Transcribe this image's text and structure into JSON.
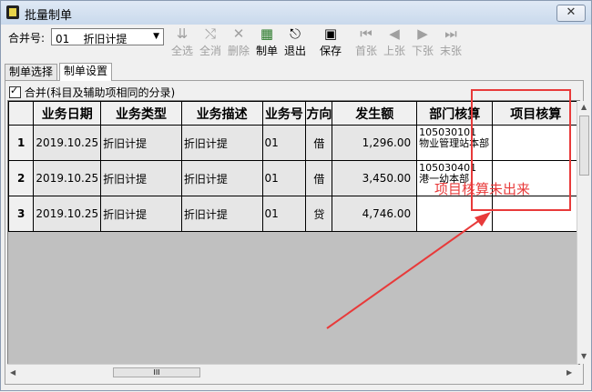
{
  "window": {
    "title": "批量制单",
    "close": "✕"
  },
  "toolbar": {
    "merge_label": "合并号:",
    "merge_value": "01",
    "merge_option": "折旧计提",
    "buttons": [
      {
        "label": "全选",
        "icon": "select-all-icon",
        "glyph": "⇊"
      },
      {
        "label": "全消",
        "icon": "deselect-all-icon",
        "glyph": "⤭"
      },
      {
        "label": "删除",
        "icon": "delete-icon",
        "glyph": "✕"
      },
      {
        "label": "制单",
        "icon": "make-voucher-icon",
        "glyph": "▦"
      },
      {
        "label": "退出",
        "icon": "exit-icon",
        "glyph": "⎋"
      },
      {
        "label": "保存",
        "icon": "save-icon",
        "glyph": "▣"
      },
      {
        "label": "首张",
        "icon": "first-icon",
        "glyph": "⏮"
      },
      {
        "label": "上张",
        "icon": "prev-icon",
        "glyph": "◀"
      },
      {
        "label": "下张",
        "icon": "next-icon",
        "glyph": "▶"
      },
      {
        "label": "末张",
        "icon": "last-icon",
        "glyph": "⏭"
      }
    ]
  },
  "tabs": [
    "制单选择",
    "制单设置"
  ],
  "merge_checkbox": "合并(科目及辅助项相同的分录)",
  "grid": {
    "columns": [
      "",
      "业务日期",
      "业务类型",
      "业务描述",
      "业务号",
      "方向",
      "发生额",
      "部门核算",
      "项目核算"
    ],
    "rows": [
      {
        "no": "1",
        "date": "2019.10.25",
        "type": "折旧计提",
        "desc": "折旧计提",
        "biz_no": "01",
        "dir": "借",
        "amount": "1,296.00",
        "dept_code": "105030101",
        "dept_name": "物业管理站本部",
        "project": ""
      },
      {
        "no": "2",
        "date": "2019.10.25",
        "type": "折旧计提",
        "desc": "折旧计提",
        "biz_no": "01",
        "dir": "借",
        "amount": "3,450.00",
        "dept_code": "105030401",
        "dept_name": "港一幼本部",
        "project": ""
      },
      {
        "no": "3",
        "date": "2019.10.25",
        "type": "折旧计提",
        "desc": "折旧计提",
        "biz_no": "01",
        "dir": "贷",
        "amount": "4,746.00",
        "dept_code": "",
        "dept_name": "",
        "project": ""
      }
    ]
  },
  "annotation": {
    "text": "项目核算未出来",
    "color": "#e83a3a"
  },
  "scroll": {
    "h_thumb": "III"
  }
}
